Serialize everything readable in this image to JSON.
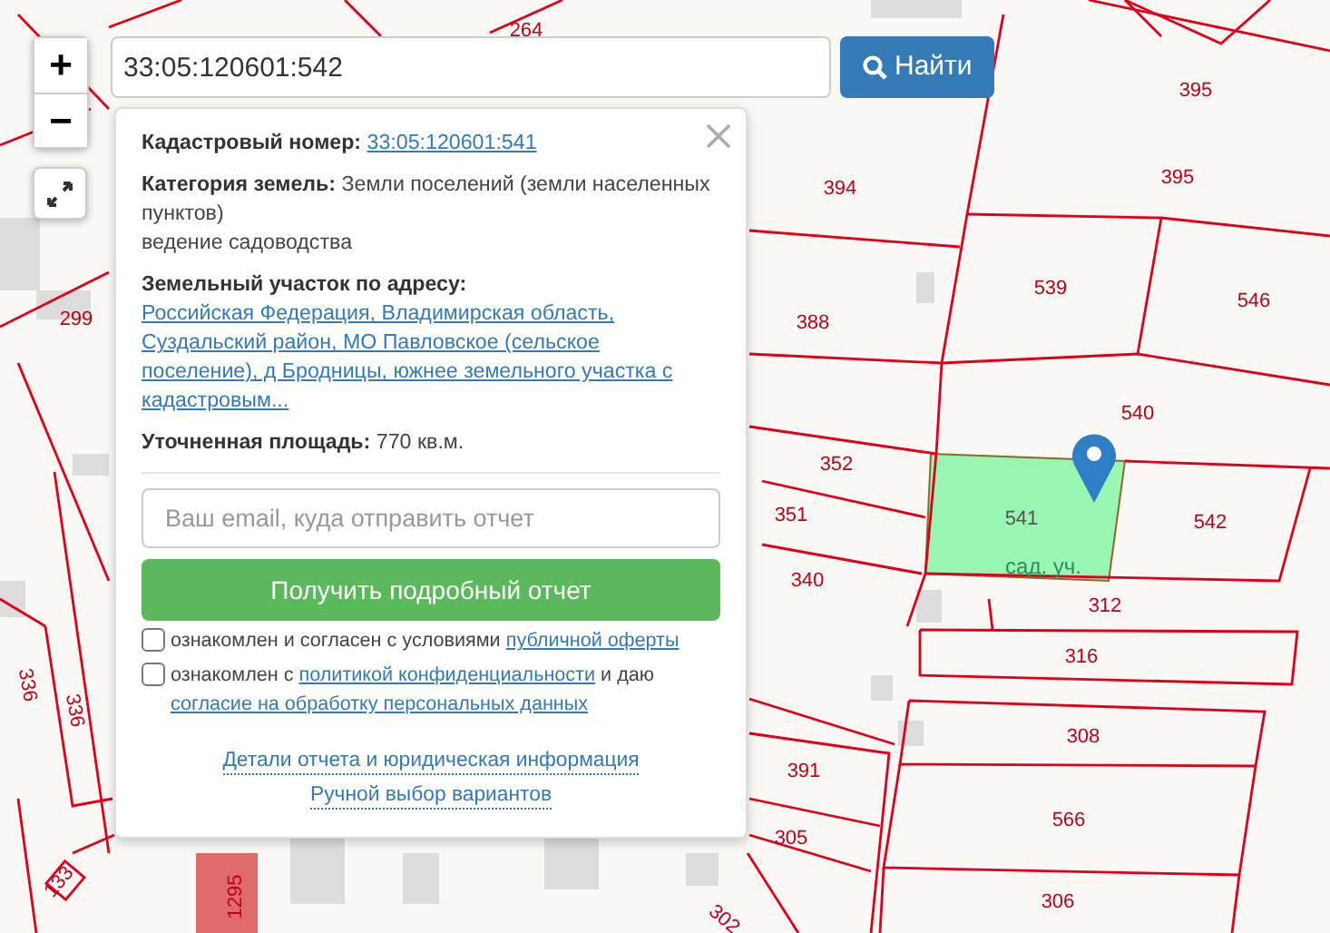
{
  "map": {
    "zoom_controls": [
      "+",
      "−"
    ],
    "parcel_labels": [
      "264",
      "395",
      "395",
      "394",
      "299",
      "388",
      "539",
      "546",
      "540",
      "352",
      "541",
      "542",
      "351",
      "340",
      "312",
      "316",
      "308",
      "391",
      "566",
      "305",
      "306",
      "302",
      "336",
      "336",
      "133",
      "1295"
    ],
    "selected_parcel_label": "сад. уч."
  },
  "search": {
    "value": "33:05:120601:542",
    "button": "Найти"
  },
  "popup": {
    "rows": [
      {
        "label": "Кадастровый номер:",
        "value": "33:05:120601:541",
        "kind": "link"
      },
      {
        "text": "**Категория земель:** Земли поселений (земли населенных пунктов)",
        "extra": "ведение садоводства",
        "kind": "text"
      },
      {
        "label": "Земельный участок по адресу:",
        "value": "Российская Федерация, Владимирская область, Суздальский район, МО Павловское (сельское поселение), д Бродницы, южнее земельного участка с кадастровым...",
        "kind": "link"
      },
      {
        "text": "**Уточненная площадь:** 770 кв.м.",
        "kind": "text"
      }
    ],
    "email": {
      "placeholder": "Ваш email, куда отправить отчет"
    },
    "submit": "Получить подробный отчет",
    "consents": [
      {
        "checked": false,
        "parts": [
          {
            "text": "ознакомлен и согласен с условиями ",
            "kind": "text"
          },
          {
            "text": "публичной оферты",
            "kind": "link"
          }
        ]
      },
      {
        "checked": false,
        "parts": [
          {
            "text": "ознакомлен с ",
            "kind": "text"
          },
          {
            "text": "политикой конфиденциальности",
            "kind": "link"
          },
          {
            "text": " и даю ",
            "kind": "text"
          },
          {
            "text": "согласие на обработку персональных данных",
            "kind": "link"
          }
        ]
      }
    ],
    "footer_links": [
      "Детали отчета и юридическая информация",
      "Ручной выбор вариантов"
    ]
  }
}
